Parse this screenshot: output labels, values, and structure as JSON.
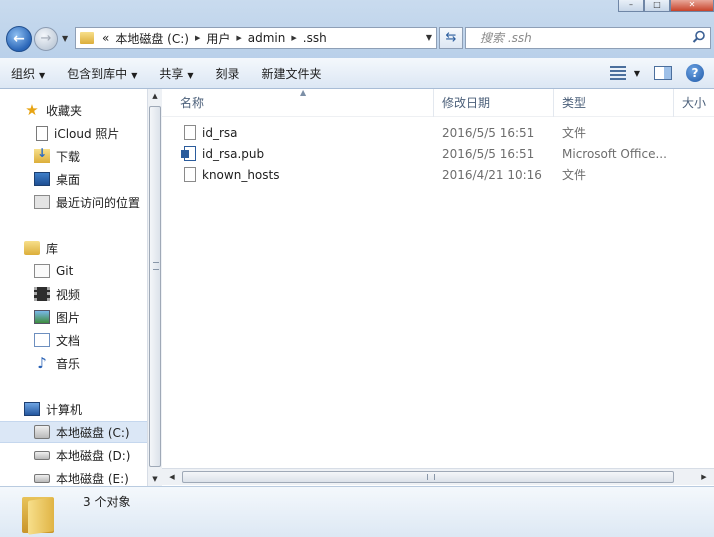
{
  "address": {
    "overflow": "«",
    "crumbs": [
      "本地磁盘 (C:)",
      "用户",
      "admin",
      ".ssh"
    ]
  },
  "search": {
    "placeholder": "搜索 .ssh"
  },
  "toolbar": {
    "organize": "组织",
    "include_in_library": "包含到库中",
    "share": "共享",
    "burn": "刻录",
    "new_folder": "新建文件夹",
    "help": "?"
  },
  "nav": {
    "favorites": {
      "label": "收藏夹",
      "items": [
        "iCloud 照片",
        "下载",
        "桌面",
        "最近访问的位置"
      ]
    },
    "libraries": {
      "label": "库",
      "items": [
        "Git",
        "视频",
        "图片",
        "文档",
        "音乐"
      ]
    },
    "computer": {
      "label": "计算机",
      "items": [
        "本地磁盘 (C:)",
        "本地磁盘 (D:)",
        "本地磁盘 (E:)"
      ],
      "selected": "本地磁盘 (C:)"
    }
  },
  "columns": {
    "name": "名称",
    "date": "修改日期",
    "type": "类型",
    "size": "大小"
  },
  "files": [
    {
      "name": "id_rsa",
      "date": "2016/5/5 16:51",
      "type": "文件",
      "icon": "file-icon"
    },
    {
      "name": "id_rsa.pub",
      "date": "2016/5/5 16:51",
      "type": "Microsoft Office...",
      "icon": "publisher-file-icon"
    },
    {
      "name": "known_hosts",
      "date": "2016/4/21 10:16",
      "type": "文件",
      "icon": "file-icon"
    }
  ],
  "status": {
    "count": "3 个对象"
  },
  "colors": {
    "chrome": "#cfe0f1",
    "selection": "#dbe7f6",
    "accent": "#2a66b8"
  }
}
